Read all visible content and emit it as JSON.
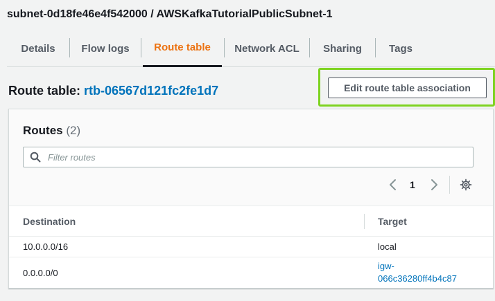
{
  "header": {
    "title": "subnet-0d18fe46e4f542000 / AWSKafkaTutorialPublicSubnet-1"
  },
  "tabs": [
    {
      "label": "Details"
    },
    {
      "label": "Flow logs"
    },
    {
      "label": "Route table",
      "active": true
    },
    {
      "label": "Network ACL"
    },
    {
      "label": "Sharing"
    },
    {
      "label": "Tags"
    }
  ],
  "route_table": {
    "label": "Route table:",
    "id": "rtb-06567d121fc2fe1d7",
    "edit_button": "Edit route table association"
  },
  "routes": {
    "title": "Routes",
    "count": "(2)",
    "filter_placeholder": "Filter routes",
    "page": "1",
    "columns": [
      "Destination",
      "Target"
    ],
    "rows": [
      {
        "destination": "10.0.0.0/16",
        "target_line1": "local",
        "target_line2": ""
      },
      {
        "destination": "0.0.0.0/0",
        "target_line1": "igw-",
        "target_line2": "066c36280ff4b4c87"
      }
    ]
  },
  "colors": {
    "accent_orange": "#ec7211",
    "link_blue": "#0073bb",
    "highlight_green": "#7ed321"
  }
}
